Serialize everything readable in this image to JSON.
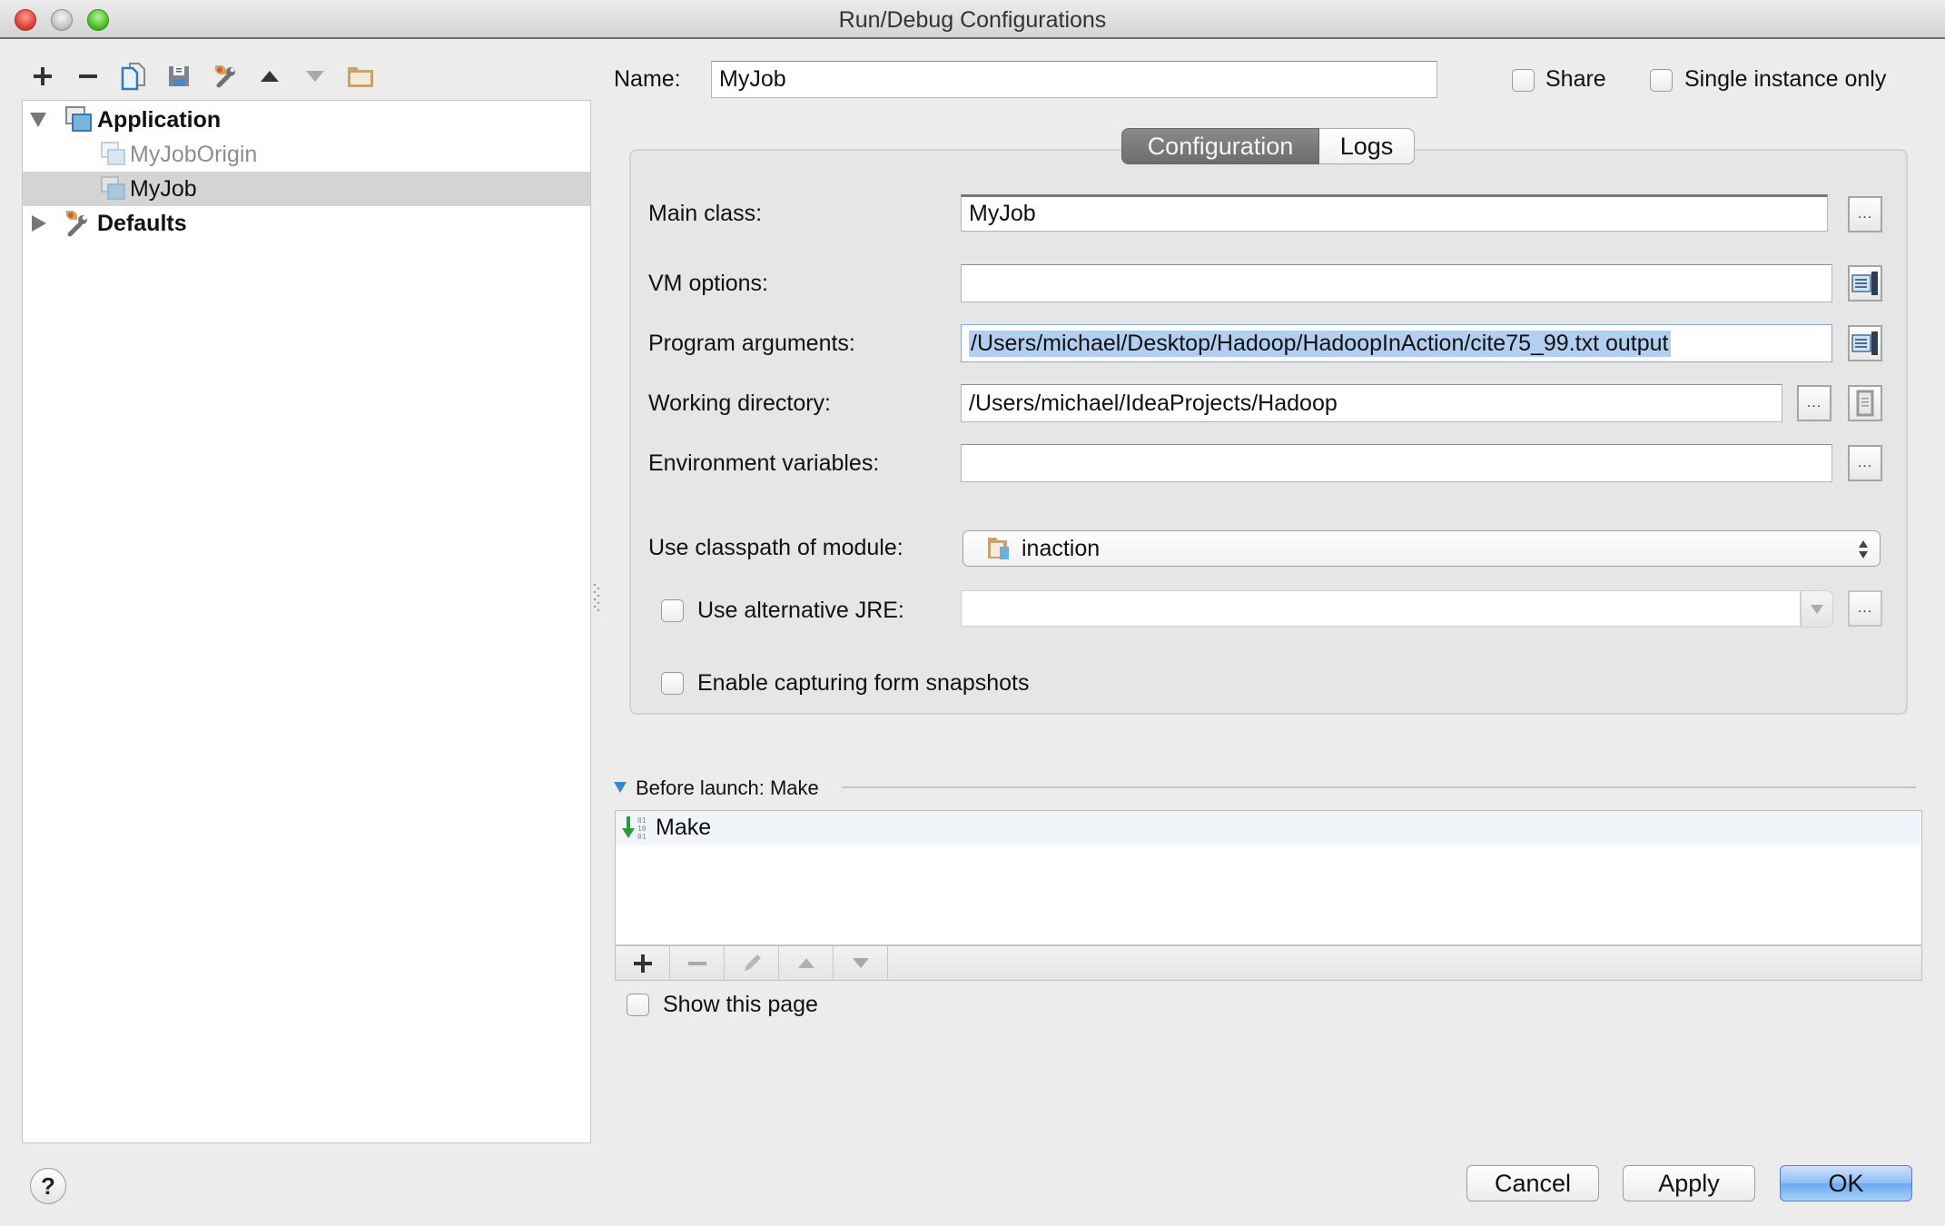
{
  "window": {
    "title": "Run/Debug Configurations"
  },
  "toolbar": {
    "items": [
      {
        "icon": "plus-icon",
        "label": "Add New Configuration"
      },
      {
        "icon": "minus-icon",
        "label": "Remove Configuration"
      },
      {
        "icon": "copy-icon",
        "label": "Copy Configuration"
      },
      {
        "icon": "save-icon",
        "label": "Save Configuration"
      },
      {
        "icon": "edit-defaults-icon",
        "label": "Edit Defaults"
      },
      {
        "icon": "move-up-icon",
        "label": "Move Up"
      },
      {
        "icon": "move-down-icon",
        "label": "Move Down"
      },
      {
        "icon": "folder-icon",
        "label": "Create New Folder"
      }
    ]
  },
  "tree": {
    "items": [
      {
        "label": "Application",
        "level": 0,
        "expanded": true,
        "bold": true,
        "icon": "application-icon"
      },
      {
        "label": "MyJobOrigin",
        "level": 1,
        "dimmed": true,
        "icon": "application-config-icon"
      },
      {
        "label": "MyJob",
        "level": 1,
        "selected": true,
        "icon": "application-config-icon"
      },
      {
        "label": "Defaults",
        "level": 0,
        "expanded": false,
        "bold": true,
        "icon": "defaults-icon"
      }
    ]
  },
  "header": {
    "name_label": "Name:",
    "name_value": "MyJob",
    "share_label": "Share",
    "share_checked": false,
    "single_instance_label": "Single instance only",
    "single_instance_checked": false
  },
  "tabs": [
    {
      "label": "Configuration",
      "active": true
    },
    {
      "label": "Logs",
      "active": false
    }
  ],
  "config": {
    "main_class_label": "Main class:",
    "main_class_value": "MyJob",
    "vm_options_label": "VM options:",
    "vm_options_value": "",
    "program_args_label": "Program arguments:",
    "program_args_value": "/Users/michael/Desktop/Hadoop/HadoopInAction/cite75_99.txt output",
    "working_dir_label": "Working directory:",
    "working_dir_value": "/Users/michael/IdeaProjects/Hadoop",
    "env_vars_label": "Environment variables:",
    "env_vars_value": "",
    "classpath_label": "Use classpath of module:",
    "classpath_value": "inaction",
    "alt_jre_label": "Use alternative JRE:",
    "alt_jre_checked": false,
    "alt_jre_value": "",
    "snapshots_label": "Enable capturing form snapshots",
    "snapshots_checked": false,
    "browse_label": "..."
  },
  "before_launch": {
    "title": "Before launch: Make",
    "items": [
      {
        "label": "Make",
        "icon": "make-icon"
      }
    ],
    "toolbar": [
      "add",
      "remove",
      "edit",
      "move-up",
      "move-down"
    ],
    "show_page_label": "Show this page",
    "show_page_checked": false
  },
  "footer": {
    "help_label": "?",
    "cancel_label": "Cancel",
    "apply_label": "Apply",
    "ok_label": "OK"
  },
  "colors": {
    "selection_highlight": "#b2cff2",
    "ok_button": "#6aa8f0",
    "active_tab": "#7a7a7a",
    "tree_selected": "#d4d4d4"
  }
}
